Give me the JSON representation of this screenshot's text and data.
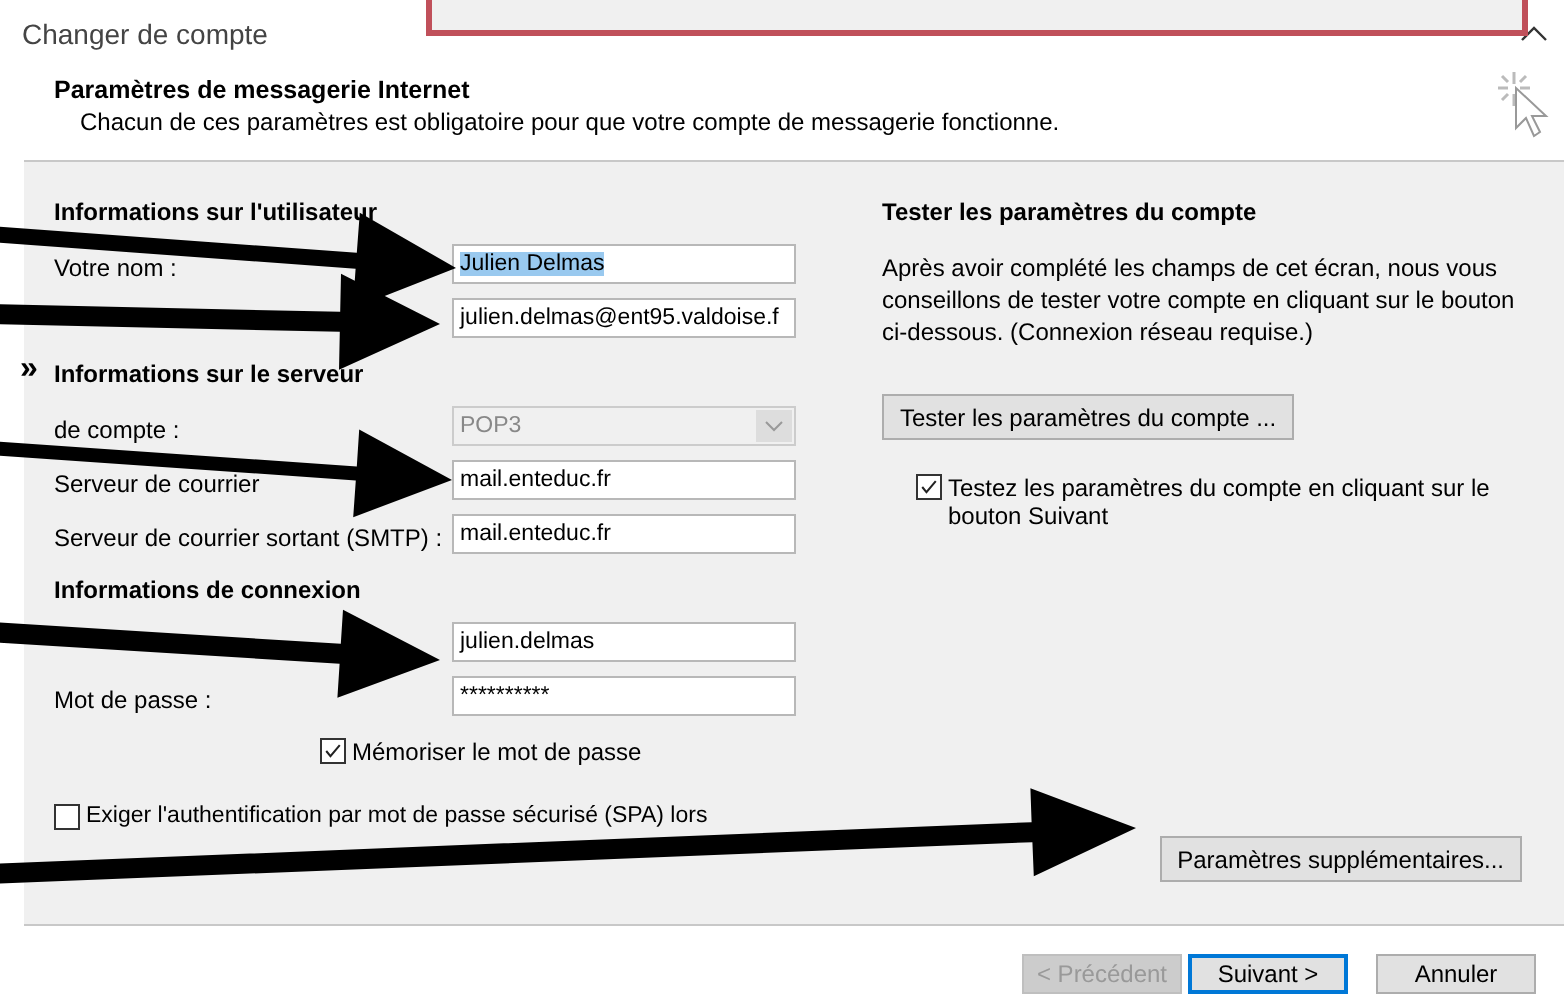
{
  "window": {
    "title": "Changer de compte"
  },
  "header": {
    "title": "Paramètres de messagerie Internet",
    "subtitle": "Chacun de ces paramètres est obligatoire pour que votre compte de messagerie fonctionne."
  },
  "side_mark": "»",
  "sections": [
    {
      "title": "Informations sur l'utilisateur",
      "rows": [
        {
          "kind": "text",
          "label": "Votre nom :",
          "value": "Julien Delmas",
          "highlighted": true
        },
        {
          "kind": "text",
          "value": "julien.delmas@ent95.valdoise.f",
          "highlighted": false
        }
      ]
    },
    {
      "title": "Informations sur le serveur",
      "rows": [
        {
          "kind": "dropdown",
          "label": "de compte :",
          "value": "POP3",
          "disabled": true
        },
        {
          "kind": "text",
          "label": "Serveur de courrier",
          "value": "mail.enteduc.fr",
          "highlighted": false
        },
        {
          "kind": "text",
          "label": "Serveur de courrier sortant (SMTP) :",
          "value": "mail.enteduc.fr",
          "highlighted": false
        }
      ]
    },
    {
      "title": "Informations de connexion",
      "rows": [
        {
          "kind": "text",
          "value": "julien.delmas",
          "highlighted": false
        },
        {
          "kind": "text",
          "label": "Mot de passe :",
          "value": "**********",
          "highlighted": false
        },
        {
          "kind": "checkbox",
          "label": "Mémoriser le mot de passe",
          "checked": true
        }
      ]
    }
  ],
  "spa": {
    "label": "Exiger l'authentification par mot de passe sécurisé (SPA) lors",
    "checked": false
  },
  "test": {
    "title": "Tester les paramètres du compte",
    "description": "Après avoir complété les champs de cet écran, nous vous conseillons de tester votre compte en cliquant sur le bouton ci-dessous. (Connexion réseau requise.)",
    "button": "Tester les paramètres du compte ...",
    "checkbox": {
      "label": "Testez les paramètres du compte en cliquant sur le bouton Suivant",
      "checked": true
    }
  },
  "more_button": "Paramètres supplémentaires...",
  "footer": {
    "buttons": [
      {
        "label": "< Précédent",
        "disabled": true,
        "default": false
      },
      {
        "label": "Suivant >",
        "disabled": false,
        "default": true
      },
      {
        "label": "Annuler",
        "disabled": false,
        "default": false
      }
    ]
  }
}
